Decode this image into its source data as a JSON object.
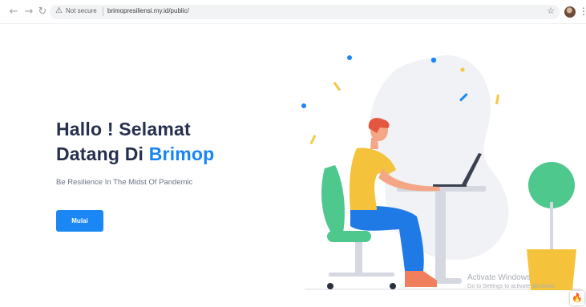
{
  "browser": {
    "back_icon": "arrow-left",
    "forward_icon": "arrow-right",
    "reload_icon": "reload",
    "security_label": "Not secure",
    "url": "brimopresiliensi.my.id/public/",
    "bookmark_icon": "star",
    "menu_icon": "more-vertical"
  },
  "hero": {
    "title_line1": "Hallo ! Selamat",
    "title_line2_prefix": "Datang Di ",
    "title_brand": "Brimop",
    "subtitle": "Be Resilience In The Midst Of Pandemic",
    "cta_label": "Mulai"
  },
  "colors": {
    "title": "#26304d",
    "brand": "#1685f5",
    "button": "#1a87f5"
  },
  "watermark": {
    "line1": "Activate Windows",
    "line2": "Go to Settings to activate Windows."
  }
}
